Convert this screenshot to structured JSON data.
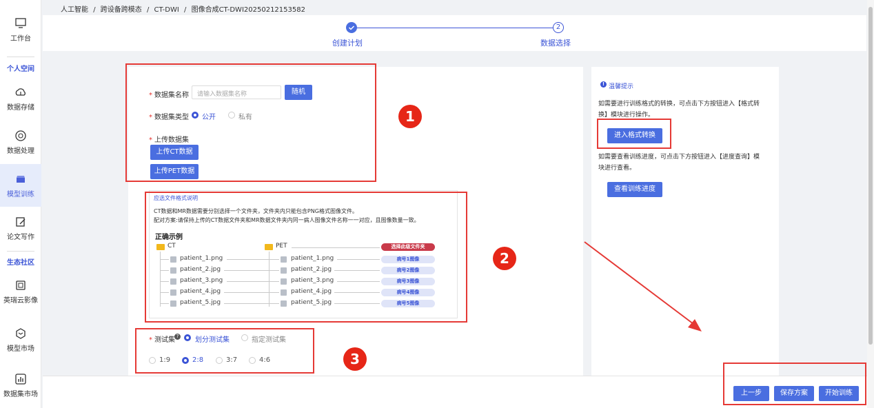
{
  "breadcrumb": [
    "人工智能",
    "/",
    "跨设备跨模态",
    "/",
    "CT-DWI",
    "/",
    "图像合成CT-DWI20250212153582"
  ],
  "sidebar": {
    "items": [
      {
        "label": "工作台",
        "icon": "monitor-icon"
      },
      {
        "label": "数据存储",
        "icon": "cloud-upload-icon"
      },
      {
        "label": "数据处理",
        "icon": "aperture-icon"
      },
      {
        "label": "模型训练",
        "icon": "box-icon"
      },
      {
        "label": "论文写作",
        "icon": "edit-icon"
      },
      {
        "label": "英瑞云影像",
        "icon": "image-icon"
      },
      {
        "label": "模型市场",
        "icon": "hexagon-icon"
      },
      {
        "label": "数据集市场",
        "icon": "bar-chart-icon"
      }
    ],
    "sections": [
      "个人空间",
      "生态社区"
    ]
  },
  "steps": [
    {
      "label": "创建计划",
      "marker": "✓"
    },
    {
      "label": "数据选择",
      "marker": "2"
    }
  ],
  "form": {
    "name_label": "数据集名称",
    "name_placeholder": "请输入数据集名称",
    "random_btn": "随机",
    "type_label": "数据集类型",
    "type_public": "公开",
    "type_private": "私有",
    "upload_label": "上传数据集",
    "upload_ct": "上传CT数据",
    "upload_pet": "上传PET数据",
    "test_label": "测试集",
    "test_split": "划分测试集",
    "test_specify": "指定测试集",
    "ratios": [
      "1:9",
      "2:8",
      "3:7",
      "4:6"
    ]
  },
  "example": {
    "link": "应选文件格式说明",
    "line1": "CT数据和MR数据需要分别选择一个文件夹，文件夹内只能包含PNG格式图像文件。",
    "line2": "配对方案:请保持上传的CT数据文件夹和MR数据文件夹内同一病人图像文件名称一一对应，且图像数量一致。",
    "title": "正确示例",
    "folder_ct": "CT",
    "folder_pet": "PET",
    "ct_files": [
      "patient_1.png",
      "patient_2.jpg",
      "patient_3.png",
      "patient_4.jpg",
      "patient_5.jpg"
    ],
    "pet_files": [
      "patient_1.png",
      "patient_2.jpg",
      "patient_3.png",
      "patient_4.jpg",
      "patient_5.jpg"
    ],
    "folder_pill": "选择此级文件夹",
    "pills": [
      "病号1图像",
      "病号2图像",
      "病号3图像",
      "病号4图像",
      "病号5图像"
    ]
  },
  "tips": {
    "title": "温馨提示",
    "text1": "如需要进行训练格式的转换，可点击下方按钮进入【格式转换】模块进行操作。",
    "format_btn": "进入格式转换",
    "text2": "如需要查看训练进度，可点击下方按钮进入【进度查询】模块进行查看。",
    "progress_btn": "查看训练进度"
  },
  "bottom": {
    "prev": "上一步",
    "save": "保存方案",
    "start": "开始训练"
  },
  "badges": [
    "1",
    "2",
    "3"
  ],
  "colors": {
    "primary": "#4a6ee0",
    "annotation": "#e53935"
  }
}
